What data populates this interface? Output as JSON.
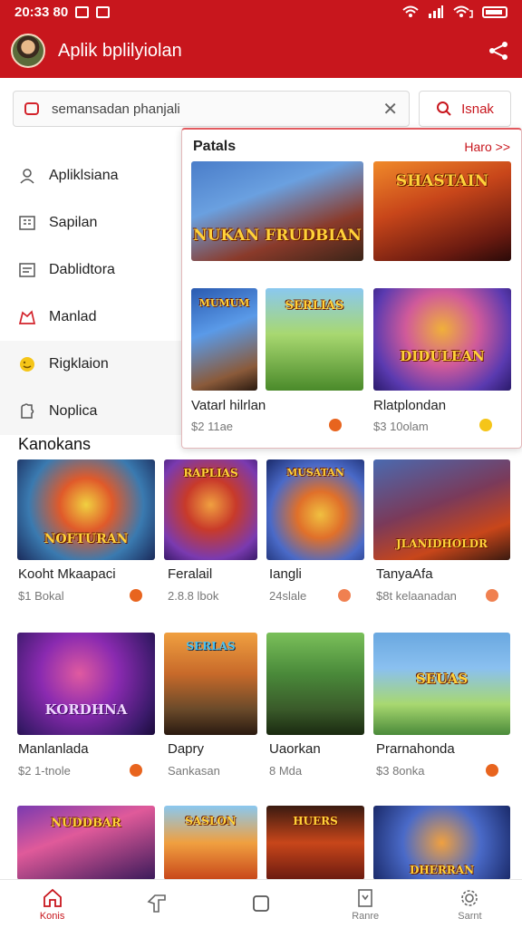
{
  "status_bar": {
    "time": "20:33 80",
    "icons": [
      "wifi-icon",
      "signal-icon",
      "wifi-calling-icon",
      "battery-icon"
    ]
  },
  "app_bar": {
    "title": "Aplik bplilyiolan",
    "share_icon": "share-icon"
  },
  "search": {
    "placeholder": "semansadan phanjali",
    "value": "semansadan phanjali",
    "button_label": "Isnak"
  },
  "sidebar": {
    "items": [
      {
        "label": "Apliklsiana",
        "icon": "user-icon"
      },
      {
        "label": "Sapilan",
        "icon": "grid-icon"
      },
      {
        "label": "Dablidtora",
        "icon": "list-icon"
      },
      {
        "label": "Manlad",
        "icon": "home-icon"
      },
      {
        "label": "Rigklaion",
        "icon": "smile-icon"
      },
      {
        "label": "Noplica",
        "icon": "puzzle-icon"
      }
    ]
  },
  "popup": {
    "title": "Patals",
    "more": "Haro >>",
    "featured": [
      {
        "art": "NUKAN FRUDBIAN"
      },
      {
        "art": "SHASTAIN"
      }
    ],
    "cards": [
      {
        "title": "Vatarl hilrlan",
        "meta": "$2 11ae",
        "art": "MUMUM"
      },
      {
        "art": "SERLIAS"
      },
      {
        "title": "Rlatplondan",
        "meta": "$3 10olam",
        "art": "DIDULEAN"
      }
    ]
  },
  "section": {
    "title": "Kanokans"
  },
  "grid": {
    "row1": [
      {
        "title": "Kooht Mkaapaci",
        "meta": "$1 Bokal",
        "art": "NOFTURAN"
      },
      {
        "title": "Feralail",
        "meta": "2.8.8 lbok",
        "art": "RAPLIAS"
      },
      {
        "title": "Iangli",
        "meta": "24slale",
        "art": "MUSATAN"
      },
      {
        "title": "TanyaAfa",
        "meta": "$8t kelaanadan",
        "art": "JLANIDHOLDR"
      }
    ],
    "row2": [
      {
        "title": "Manlanlada",
        "meta": "$2 1-tnole",
        "art": "KORDHNA"
      },
      {
        "title": "Dapry",
        "meta": "Sankasan",
        "art": "SERLAS"
      },
      {
        "title": "Uaorkan",
        "meta": "8 Mda",
        "art": ""
      },
      {
        "title": "Prarnahonda",
        "meta": "$3 8onka",
        "art": "SEUAS"
      }
    ],
    "row3": [
      {
        "art": "NUDDBAR"
      },
      {
        "art": "SASLON"
      },
      {
        "art": "HUERS"
      },
      {
        "art": "DHERRAN"
      }
    ]
  },
  "navbar": {
    "items": [
      {
        "label": "Konis",
        "icon": "home-icon"
      },
      {
        "label": "",
        "icon": "tag-icon"
      },
      {
        "label": "",
        "icon": "square-icon"
      },
      {
        "label": "Ranre",
        "icon": "bookmark-icon"
      },
      {
        "label": "Sarnt",
        "icon": "settings-icon"
      }
    ]
  }
}
